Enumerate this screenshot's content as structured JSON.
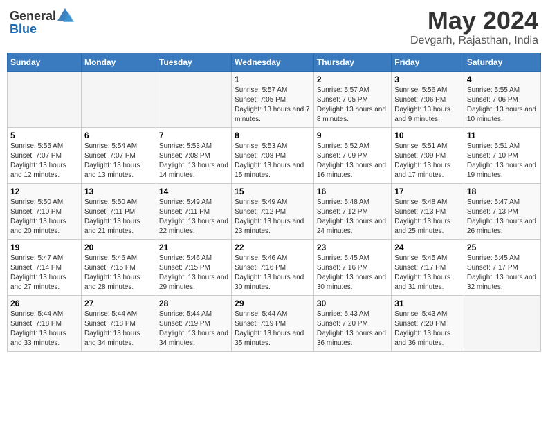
{
  "header": {
    "logo_line1": "General",
    "logo_line2": "Blue",
    "main_title": "May 2024",
    "sub_title": "Devgarh, Rajasthan, India"
  },
  "days_of_week": [
    "Sunday",
    "Monday",
    "Tuesday",
    "Wednesday",
    "Thursday",
    "Friday",
    "Saturday"
  ],
  "weeks": [
    [
      {
        "num": "",
        "sunrise": "",
        "sunset": "",
        "daylight": ""
      },
      {
        "num": "",
        "sunrise": "",
        "sunset": "",
        "daylight": ""
      },
      {
        "num": "",
        "sunrise": "",
        "sunset": "",
        "daylight": ""
      },
      {
        "num": "1",
        "sunrise": "Sunrise: 5:57 AM",
        "sunset": "Sunset: 7:05 PM",
        "daylight": "Daylight: 13 hours and 7 minutes."
      },
      {
        "num": "2",
        "sunrise": "Sunrise: 5:57 AM",
        "sunset": "Sunset: 7:05 PM",
        "daylight": "Daylight: 13 hours and 8 minutes."
      },
      {
        "num": "3",
        "sunrise": "Sunrise: 5:56 AM",
        "sunset": "Sunset: 7:06 PM",
        "daylight": "Daylight: 13 hours and 9 minutes."
      },
      {
        "num": "4",
        "sunrise": "Sunrise: 5:55 AM",
        "sunset": "Sunset: 7:06 PM",
        "daylight": "Daylight: 13 hours and 10 minutes."
      }
    ],
    [
      {
        "num": "5",
        "sunrise": "Sunrise: 5:55 AM",
        "sunset": "Sunset: 7:07 PM",
        "daylight": "Daylight: 13 hours and 12 minutes."
      },
      {
        "num": "6",
        "sunrise": "Sunrise: 5:54 AM",
        "sunset": "Sunset: 7:07 PM",
        "daylight": "Daylight: 13 hours and 13 minutes."
      },
      {
        "num": "7",
        "sunrise": "Sunrise: 5:53 AM",
        "sunset": "Sunset: 7:08 PM",
        "daylight": "Daylight: 13 hours and 14 minutes."
      },
      {
        "num": "8",
        "sunrise": "Sunrise: 5:53 AM",
        "sunset": "Sunset: 7:08 PM",
        "daylight": "Daylight: 13 hours and 15 minutes."
      },
      {
        "num": "9",
        "sunrise": "Sunrise: 5:52 AM",
        "sunset": "Sunset: 7:09 PM",
        "daylight": "Daylight: 13 hours and 16 minutes."
      },
      {
        "num": "10",
        "sunrise": "Sunrise: 5:51 AM",
        "sunset": "Sunset: 7:09 PM",
        "daylight": "Daylight: 13 hours and 17 minutes."
      },
      {
        "num": "11",
        "sunrise": "Sunrise: 5:51 AM",
        "sunset": "Sunset: 7:10 PM",
        "daylight": "Daylight: 13 hours and 19 minutes."
      }
    ],
    [
      {
        "num": "12",
        "sunrise": "Sunrise: 5:50 AM",
        "sunset": "Sunset: 7:10 PM",
        "daylight": "Daylight: 13 hours and 20 minutes."
      },
      {
        "num": "13",
        "sunrise": "Sunrise: 5:50 AM",
        "sunset": "Sunset: 7:11 PM",
        "daylight": "Daylight: 13 hours and 21 minutes."
      },
      {
        "num": "14",
        "sunrise": "Sunrise: 5:49 AM",
        "sunset": "Sunset: 7:11 PM",
        "daylight": "Daylight: 13 hours and 22 minutes."
      },
      {
        "num": "15",
        "sunrise": "Sunrise: 5:49 AM",
        "sunset": "Sunset: 7:12 PM",
        "daylight": "Daylight: 13 hours and 23 minutes."
      },
      {
        "num": "16",
        "sunrise": "Sunrise: 5:48 AM",
        "sunset": "Sunset: 7:12 PM",
        "daylight": "Daylight: 13 hours and 24 minutes."
      },
      {
        "num": "17",
        "sunrise": "Sunrise: 5:48 AM",
        "sunset": "Sunset: 7:13 PM",
        "daylight": "Daylight: 13 hours and 25 minutes."
      },
      {
        "num": "18",
        "sunrise": "Sunrise: 5:47 AM",
        "sunset": "Sunset: 7:13 PM",
        "daylight": "Daylight: 13 hours and 26 minutes."
      }
    ],
    [
      {
        "num": "19",
        "sunrise": "Sunrise: 5:47 AM",
        "sunset": "Sunset: 7:14 PM",
        "daylight": "Daylight: 13 hours and 27 minutes."
      },
      {
        "num": "20",
        "sunrise": "Sunrise: 5:46 AM",
        "sunset": "Sunset: 7:15 PM",
        "daylight": "Daylight: 13 hours and 28 minutes."
      },
      {
        "num": "21",
        "sunrise": "Sunrise: 5:46 AM",
        "sunset": "Sunset: 7:15 PM",
        "daylight": "Daylight: 13 hours and 29 minutes."
      },
      {
        "num": "22",
        "sunrise": "Sunrise: 5:46 AM",
        "sunset": "Sunset: 7:16 PM",
        "daylight": "Daylight: 13 hours and 30 minutes."
      },
      {
        "num": "23",
        "sunrise": "Sunrise: 5:45 AM",
        "sunset": "Sunset: 7:16 PM",
        "daylight": "Daylight: 13 hours and 30 minutes."
      },
      {
        "num": "24",
        "sunrise": "Sunrise: 5:45 AM",
        "sunset": "Sunset: 7:17 PM",
        "daylight": "Daylight: 13 hours and 31 minutes."
      },
      {
        "num": "25",
        "sunrise": "Sunrise: 5:45 AM",
        "sunset": "Sunset: 7:17 PM",
        "daylight": "Daylight: 13 hours and 32 minutes."
      }
    ],
    [
      {
        "num": "26",
        "sunrise": "Sunrise: 5:44 AM",
        "sunset": "Sunset: 7:18 PM",
        "daylight": "Daylight: 13 hours and 33 minutes."
      },
      {
        "num": "27",
        "sunrise": "Sunrise: 5:44 AM",
        "sunset": "Sunset: 7:18 PM",
        "daylight": "Daylight: 13 hours and 34 minutes."
      },
      {
        "num": "28",
        "sunrise": "Sunrise: 5:44 AM",
        "sunset": "Sunset: 7:19 PM",
        "daylight": "Daylight: 13 hours and 34 minutes."
      },
      {
        "num": "29",
        "sunrise": "Sunrise: 5:44 AM",
        "sunset": "Sunset: 7:19 PM",
        "daylight": "Daylight: 13 hours and 35 minutes."
      },
      {
        "num": "30",
        "sunrise": "Sunrise: 5:43 AM",
        "sunset": "Sunset: 7:20 PM",
        "daylight": "Daylight: 13 hours and 36 minutes."
      },
      {
        "num": "31",
        "sunrise": "Sunrise: 5:43 AM",
        "sunset": "Sunset: 7:20 PM",
        "daylight": "Daylight: 13 hours and 36 minutes."
      },
      {
        "num": "",
        "sunrise": "",
        "sunset": "",
        "daylight": ""
      }
    ]
  ]
}
